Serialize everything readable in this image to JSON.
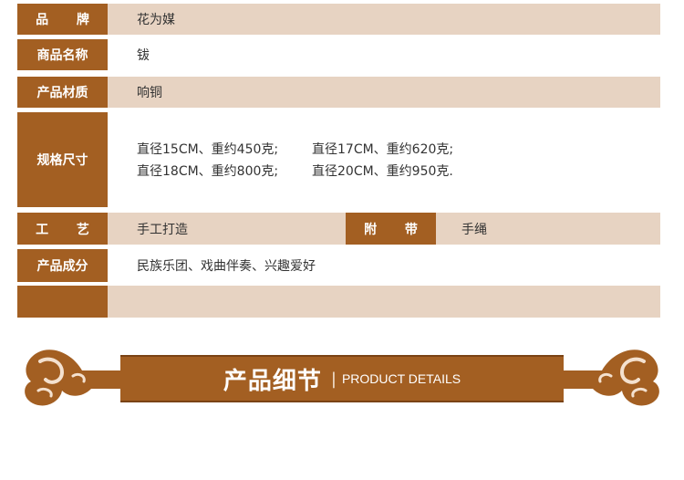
{
  "colors": {
    "label_bg": "#a35f22",
    "row_bg": "#e7d3c2",
    "text": "#333333"
  },
  "rows": [
    {
      "label": "品牌",
      "value": "花为媒"
    },
    {
      "label": "商品名称",
      "value": "钹"
    },
    {
      "label": "产品材质",
      "value": "响铜"
    },
    {
      "label": "规格尺寸",
      "specs": [
        [
          "直径15CM、重约450克;",
          "直径17CM、重约620克;"
        ],
        [
          "直径18CM、重约800克;",
          "直径20CM、重约950克."
        ]
      ]
    },
    {
      "label": "工艺",
      "value": "手工打造",
      "label2": "附带",
      "value2": "手绳"
    },
    {
      "label": "产品成分",
      "value": "民族乐团、戏曲伴奏、兴趣爱好"
    },
    {
      "label": "",
      "value": ""
    }
  ],
  "banner": {
    "title": "产品细节",
    "separator": "|",
    "subtitle": "PRODUCT DETAILS"
  }
}
